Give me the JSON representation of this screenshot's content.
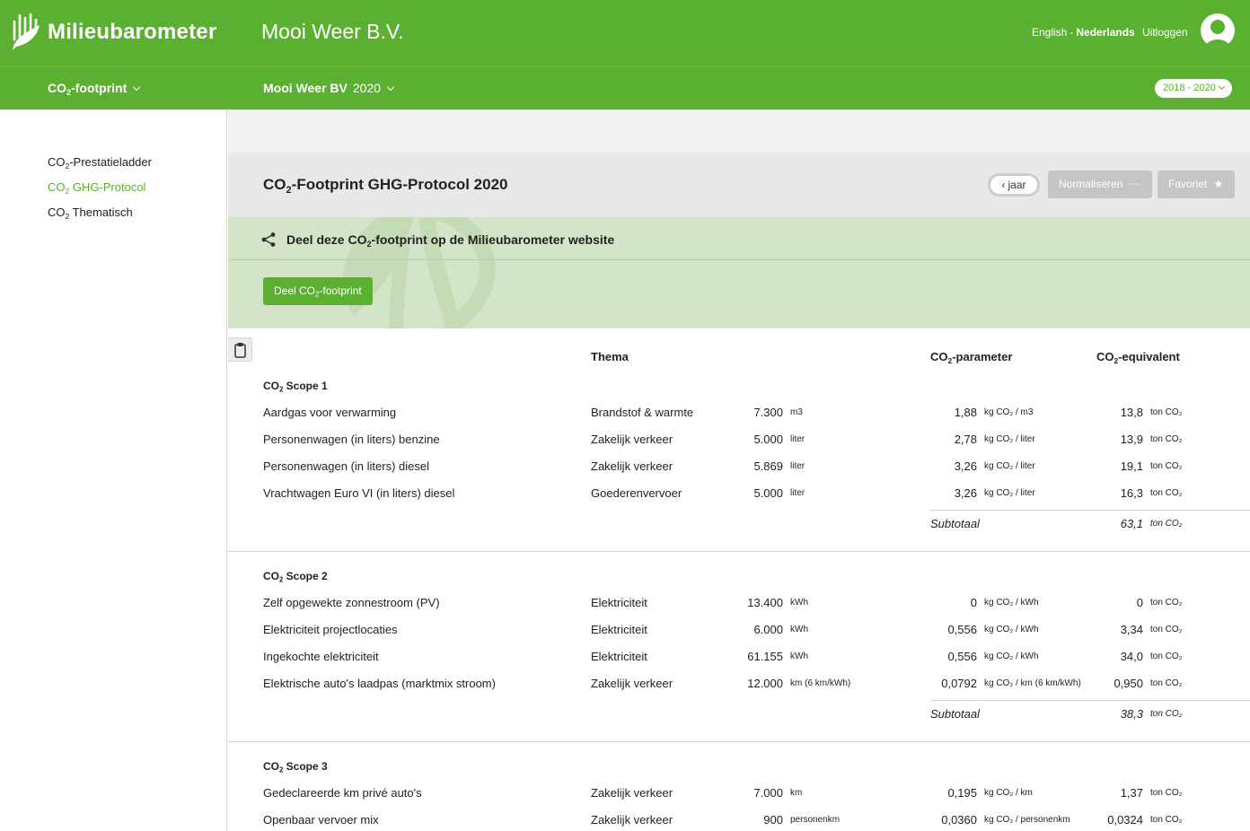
{
  "header": {
    "brand": "Milieubarometer",
    "company": "Mooi Weer B.V.",
    "lang_english": "English",
    "lang_sep": "-",
    "lang_dutch": "Nederlands",
    "logout": "Uitloggen"
  },
  "subnav": {
    "module_prefix": "CO",
    "module_sub": "2",
    "module_suffix": "-footprint",
    "org": "Mooi Weer BV",
    "year": "2020",
    "range": "2018 - 2020"
  },
  "sidebar": {
    "items": [
      {
        "prefix": "CO",
        "sub": "2",
        "suffix": "-Prestatieladder"
      },
      {
        "prefix": "CO",
        "sub": "2",
        "suffix": " GHG-Protocol"
      },
      {
        "prefix": "CO",
        "sub": "2",
        "suffix": " Thematisch"
      }
    ]
  },
  "title": {
    "prefix": "CO",
    "sub": "2",
    "suffix": "-Footprint GHG-Protocol 2020"
  },
  "buttons": {
    "year": "jaar",
    "normalize": "Normaliseren",
    "favorite": "Favoriet",
    "share_prefix": "Deel CO",
    "share_sub": "2",
    "share_suffix": "-footprint"
  },
  "share": {
    "prefix": "Deel deze CO",
    "sub": "2",
    "suffix": "-footprint op de Milieubarometer website"
  },
  "columns": {
    "thema": "Thema",
    "param_prefix": "CO",
    "param_sub": "2",
    "param_suffix": "-parameter",
    "equiv_prefix": "CO",
    "equiv_sub": "2",
    "equiv_suffix": "-equivalent"
  },
  "scopes": [
    {
      "label_prefix": "CO",
      "label_sub": "2",
      "label_suffix": " Scope 1",
      "rows": [
        {
          "name": "Aardgas voor verwarming",
          "theme": "Brandstof & warmte",
          "qty": "7.300",
          "unit": "m3",
          "param": "1,88",
          "punit": "kg CO₂ / m3",
          "eq": "13,8",
          "eunit": "ton CO₂"
        },
        {
          "name": "Personenwagen (in liters) benzine",
          "theme": "Zakelijk verkeer",
          "qty": "5.000",
          "unit": "liter",
          "param": "2,78",
          "punit": "kg CO₂ / liter",
          "eq": "13,9",
          "eunit": "ton CO₂"
        },
        {
          "name": "Personenwagen (in liters) diesel",
          "theme": "Zakelijk verkeer",
          "qty": "5.869",
          "unit": "liter",
          "param": "3,26",
          "punit": "kg CO₂ / liter",
          "eq": "19,1",
          "eunit": "ton CO₂"
        },
        {
          "name": "Vrachtwagen Euro VI (in liters) diesel",
          "theme": "Goederenvervoer",
          "qty": "5.000",
          "unit": "liter",
          "param": "3,26",
          "punit": "kg CO₂ / liter",
          "eq": "16,3",
          "eunit": "ton CO₂"
        }
      ],
      "subtotal_label": "Subtotaal",
      "subtotal_value": "63,1",
      "subtotal_unit": "ton CO₂"
    },
    {
      "label_prefix": "CO",
      "label_sub": "2",
      "label_suffix": " Scope 2",
      "rows": [
        {
          "name": "Zelf opgewekte zonnestroom (PV)",
          "theme": "Elektriciteit",
          "qty": "13.400",
          "unit": "kWh",
          "param": "0",
          "punit": "kg CO₂ / kWh",
          "eq": "0",
          "eunit": "ton CO₂"
        },
        {
          "name": "Elektriciteit projectlocaties",
          "theme": "Elektriciteit",
          "qty": "6.000",
          "unit": "kWh",
          "param": "0,556",
          "punit": "kg CO₂ / kWh",
          "eq": "3,34",
          "eunit": "ton CO₂"
        },
        {
          "name": "Ingekochte elektriciteit",
          "theme": "Elektriciteit",
          "qty": "61.155",
          "unit": "kWh",
          "param": "0,556",
          "punit": "kg CO₂ / kWh",
          "eq": "34,0",
          "eunit": "ton CO₂"
        },
        {
          "name": "Elektrische auto's laadpas (marktmix stroom)",
          "theme": "Zakelijk verkeer",
          "qty": "12.000",
          "unit": "km (6 km/kWh)",
          "param": "0,0792",
          "punit": "kg CO₂ / km (6 km/kWh)",
          "eq": "0,950",
          "eunit": "ton CO₂"
        }
      ],
      "subtotal_label": "Subtotaal",
      "subtotal_value": "38,3",
      "subtotal_unit": "ton CO₂"
    },
    {
      "label_prefix": "CO",
      "label_sub": "2",
      "label_suffix": " Scope 3",
      "rows": [
        {
          "name": "Gedeclareerde km privé auto's",
          "theme": "Zakelijk verkeer",
          "qty": "7.000",
          "unit": "km",
          "param": "0,195",
          "punit": "kg CO₂ / km",
          "eq": "1,37",
          "eunit": "ton CO₂"
        },
        {
          "name": "Openbaar vervoer mix",
          "theme": "Zakelijk verkeer",
          "qty": "900",
          "unit": "personenkm",
          "param": "0,0360",
          "punit": "kg CO₂ / personenkm",
          "eq": "0,0324",
          "eunit": "ton CO₂"
        }
      ]
    }
  ],
  "colors": {
    "brand_green": "#5bb031",
    "share_band": "#d3e4c8",
    "gray_band": "#e8e8e8"
  }
}
